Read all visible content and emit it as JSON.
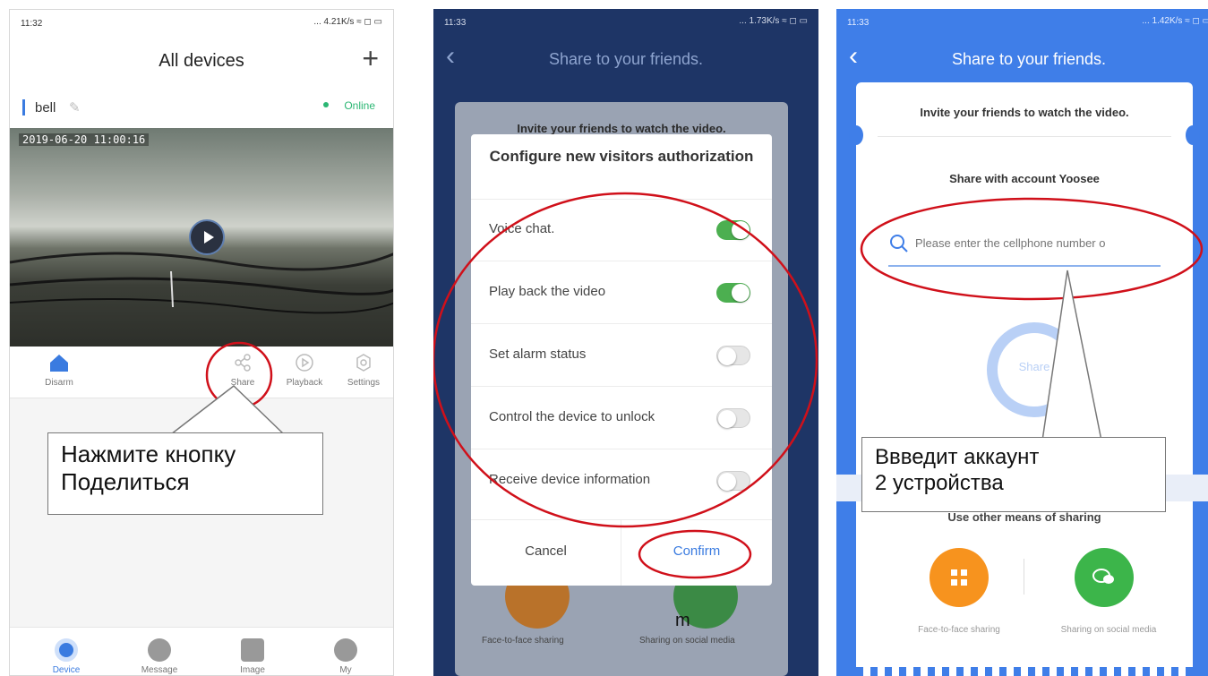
{
  "panel1": {
    "status_time": "11:32",
    "status_right": "... 4.21K/s ≈ ◻ ▭",
    "header_title": "All devices",
    "add_icon": "plus-icon",
    "device_name": "bell",
    "device_status": "Online",
    "video_timestamp": "2019-06-20  11:00:16",
    "actions": [
      {
        "label": "Disarm",
        "icon": "house-icon"
      },
      {
        "label": "Share",
        "icon": "share-icon"
      },
      {
        "label": "Playback",
        "icon": "playback-icon"
      },
      {
        "label": "Settings",
        "icon": "gear-icon"
      }
    ],
    "callout": "Нажмите кнопку\nПоделиться",
    "bottom_nav": [
      {
        "label": "Device",
        "icon": "camera-icon"
      },
      {
        "label": "Message",
        "icon": "message-icon"
      },
      {
        "label": "Image",
        "icon": "image-icon"
      },
      {
        "label": "My",
        "icon": "person-icon"
      }
    ],
    "colors": {
      "accent": "#3a7be0",
      "online": "#2bb673"
    }
  },
  "panel2": {
    "status_time": "11:33",
    "status_right": "... 1.73K/s ≈ ◻ ▭",
    "header_title": "Share to your friends.",
    "card_text": "Invite your friends to watch the video.",
    "dialog_title": "Configure new visitors authorization",
    "permissions": [
      {
        "label": "Voice chat.",
        "enabled": true
      },
      {
        "label": "Play back the video",
        "enabled": true
      },
      {
        "label": "Set alarm status",
        "enabled": false
      },
      {
        "label": "Control the device to unlock",
        "enabled": false
      },
      {
        "label": "Receive device information",
        "enabled": false
      }
    ],
    "cancel_label": "Cancel",
    "confirm_label": "Confirm",
    "bg_labels": [
      "Face-to-face sharing",
      "Sharing on social media"
    ],
    "stray_text": "m",
    "colors": {
      "background": "#1e3566",
      "toggle_on": "#4caf50",
      "confirm": "#3a7be0",
      "annotation": "#d0101a"
    }
  },
  "panel3": {
    "status_time": "11:33",
    "status_right": "... 1.42K/s ≈ ◻ ▭",
    "header_title": "Share to your friends.",
    "invite_text": "Invite your friends to watch the video.",
    "share_with": "Share with account Yoosee",
    "search_placeholder": "Please enter the cellphone number o",
    "share_button": "Share",
    "callout": "Ввведит аккаунт\n2 устройства",
    "other_means": "Use other means of sharing",
    "options": [
      {
        "label": "Face-to-face sharing",
        "icon": "qr-icon"
      },
      {
        "label": "Sharing on social media",
        "icon": "chat-icon"
      }
    ],
    "colors": {
      "background": "#3f7ee8",
      "orange": "#f7931e",
      "green": "#3cb54a"
    }
  }
}
